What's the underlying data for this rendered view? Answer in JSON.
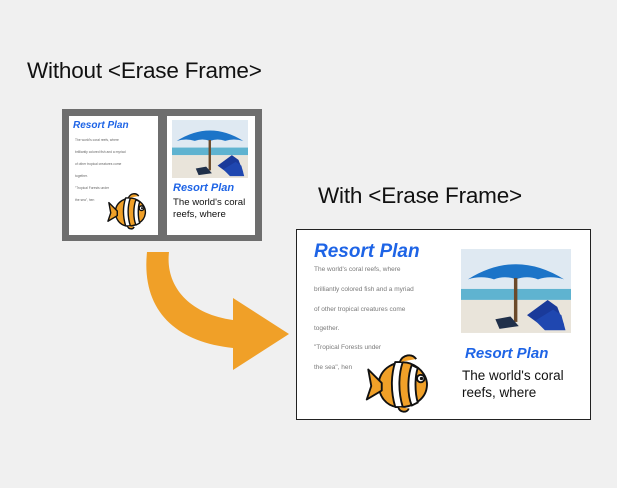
{
  "headings": {
    "without": "Without <Erase Frame>",
    "with": "With <Erase Frame>"
  },
  "document": {
    "title": "Resort Plan",
    "left_lines": [
      "The world's coral reefs, where",
      "brilliantly colored fish and a myriad",
      "of other tropical creatures come",
      "together.",
      "\"Tropical Forests under",
      "the sea\", hen"
    ],
    "right_title": "Resort Plan",
    "right_body_line1": "The world's coral",
    "right_body_line2": "reefs, where"
  },
  "colors": {
    "background": "#f0f0f0",
    "frame_gray": "#6e6e6e",
    "title_blue": "#1e64e6",
    "arrow_orange": "#f0a028"
  },
  "icons": [
    "umbrella-photo",
    "clownfish-icon",
    "curved-arrow-icon"
  ]
}
